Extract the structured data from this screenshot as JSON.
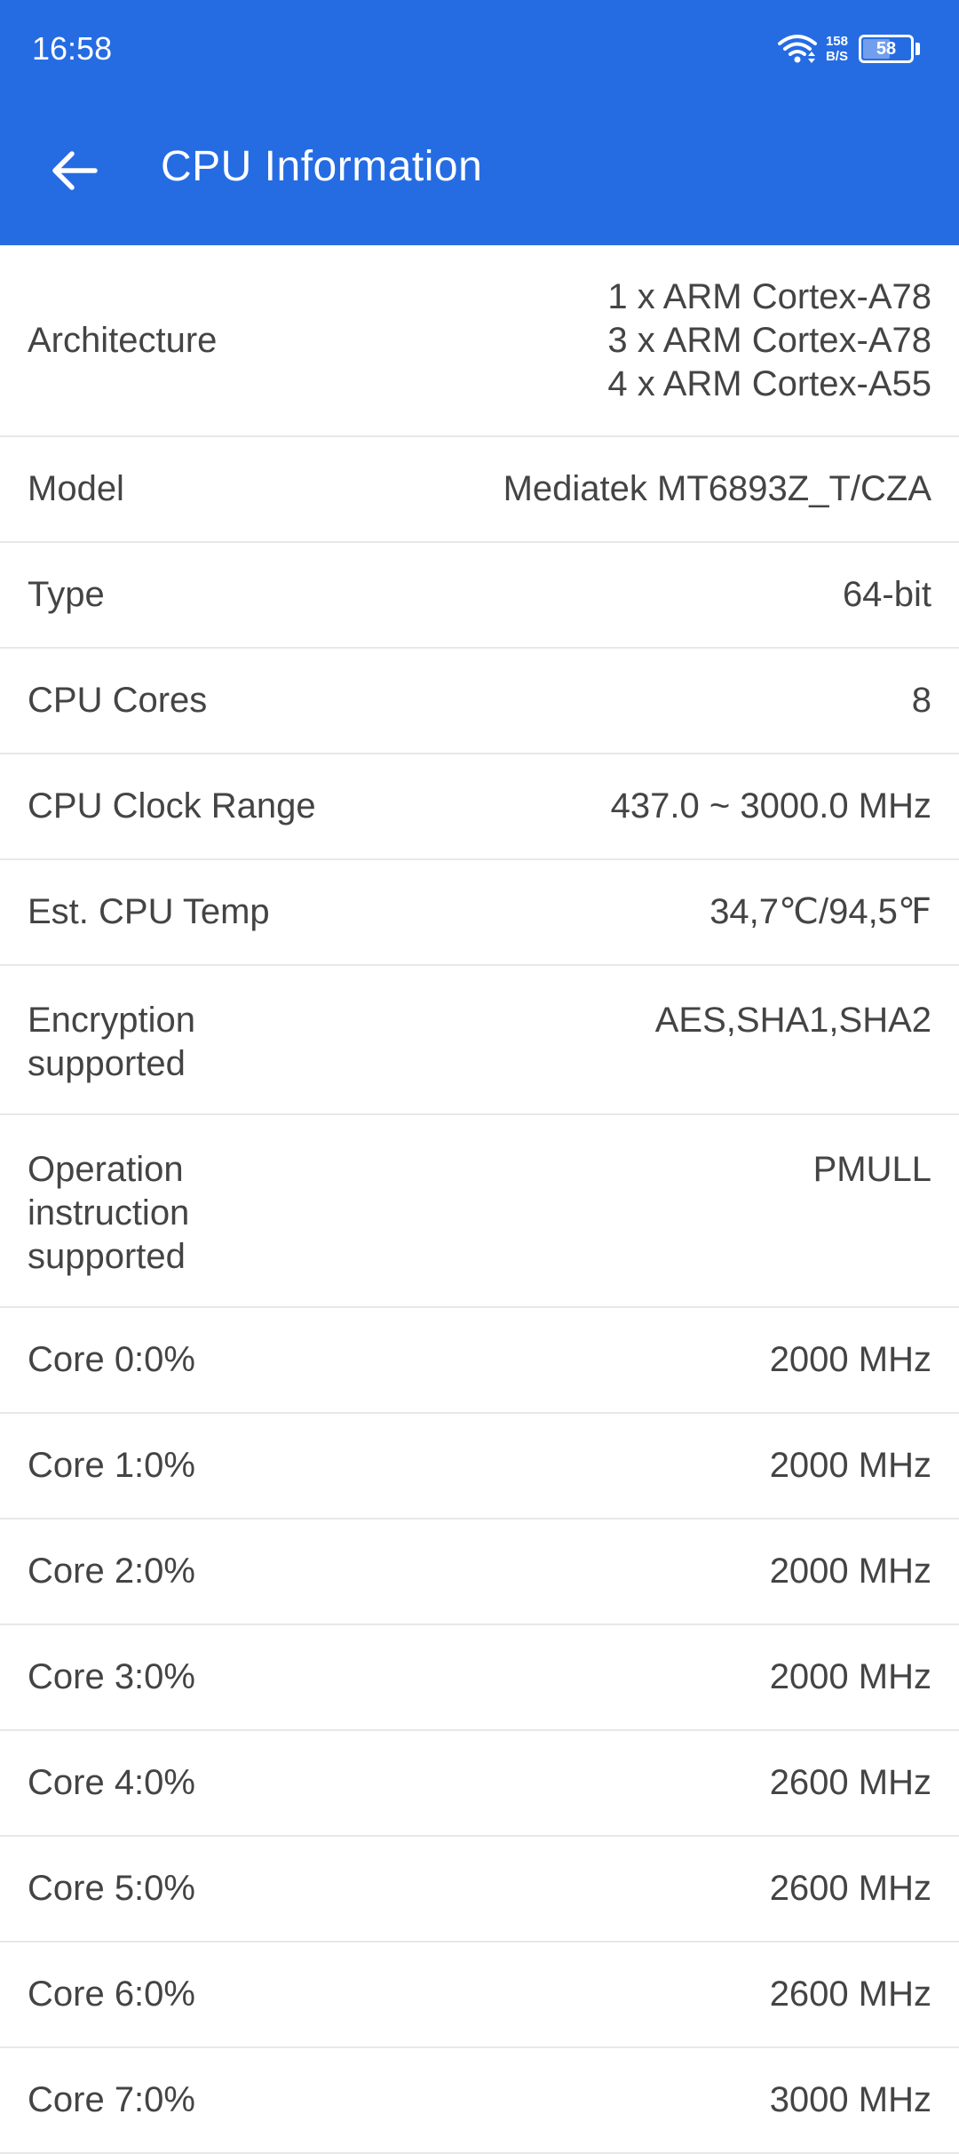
{
  "status_bar": {
    "time": "16:58",
    "net_speed_value": "158",
    "net_speed_unit": "B/S",
    "battery_level": "58",
    "battery_fraction": 0.58
  },
  "app_bar": {
    "title": "CPU Information",
    "back_icon": "arrow-left-icon"
  },
  "rows": [
    {
      "label": "Architecture",
      "value": "1 x ARM Cortex-A78\n3 x ARM Cortex-A78\n4 x ARM Cortex-A55"
    },
    {
      "label": "Model",
      "value": "Mediatek MT6893Z_T/CZA"
    },
    {
      "label": "Type",
      "value": "64-bit"
    },
    {
      "label": "CPU Cores",
      "value": "8"
    },
    {
      "label": "CPU Clock Range",
      "value": "437.0 ~ 3000.0 MHz"
    },
    {
      "label": "Est. CPU Temp",
      "value": "34,7℃/94,5℉"
    },
    {
      "label": "Encryption\nsupported",
      "value": "AES,SHA1,SHA2"
    },
    {
      "label": "Operation\ninstruction\nsupported",
      "value": "PMULL"
    },
    {
      "label": "Core 0:0%",
      "value": "2000 MHz"
    },
    {
      "label": "Core 1:0%",
      "value": "2000 MHz"
    },
    {
      "label": "Core 2:0%",
      "value": "2000 MHz"
    },
    {
      "label": "Core 3:0%",
      "value": "2000 MHz"
    },
    {
      "label": "Core 4:0%",
      "value": "2600 MHz"
    },
    {
      "label": "Core 5:0%",
      "value": "2600 MHz"
    },
    {
      "label": "Core 6:0%",
      "value": "2600 MHz"
    },
    {
      "label": "Core 7:0%",
      "value": "3000 MHz"
    }
  ]
}
